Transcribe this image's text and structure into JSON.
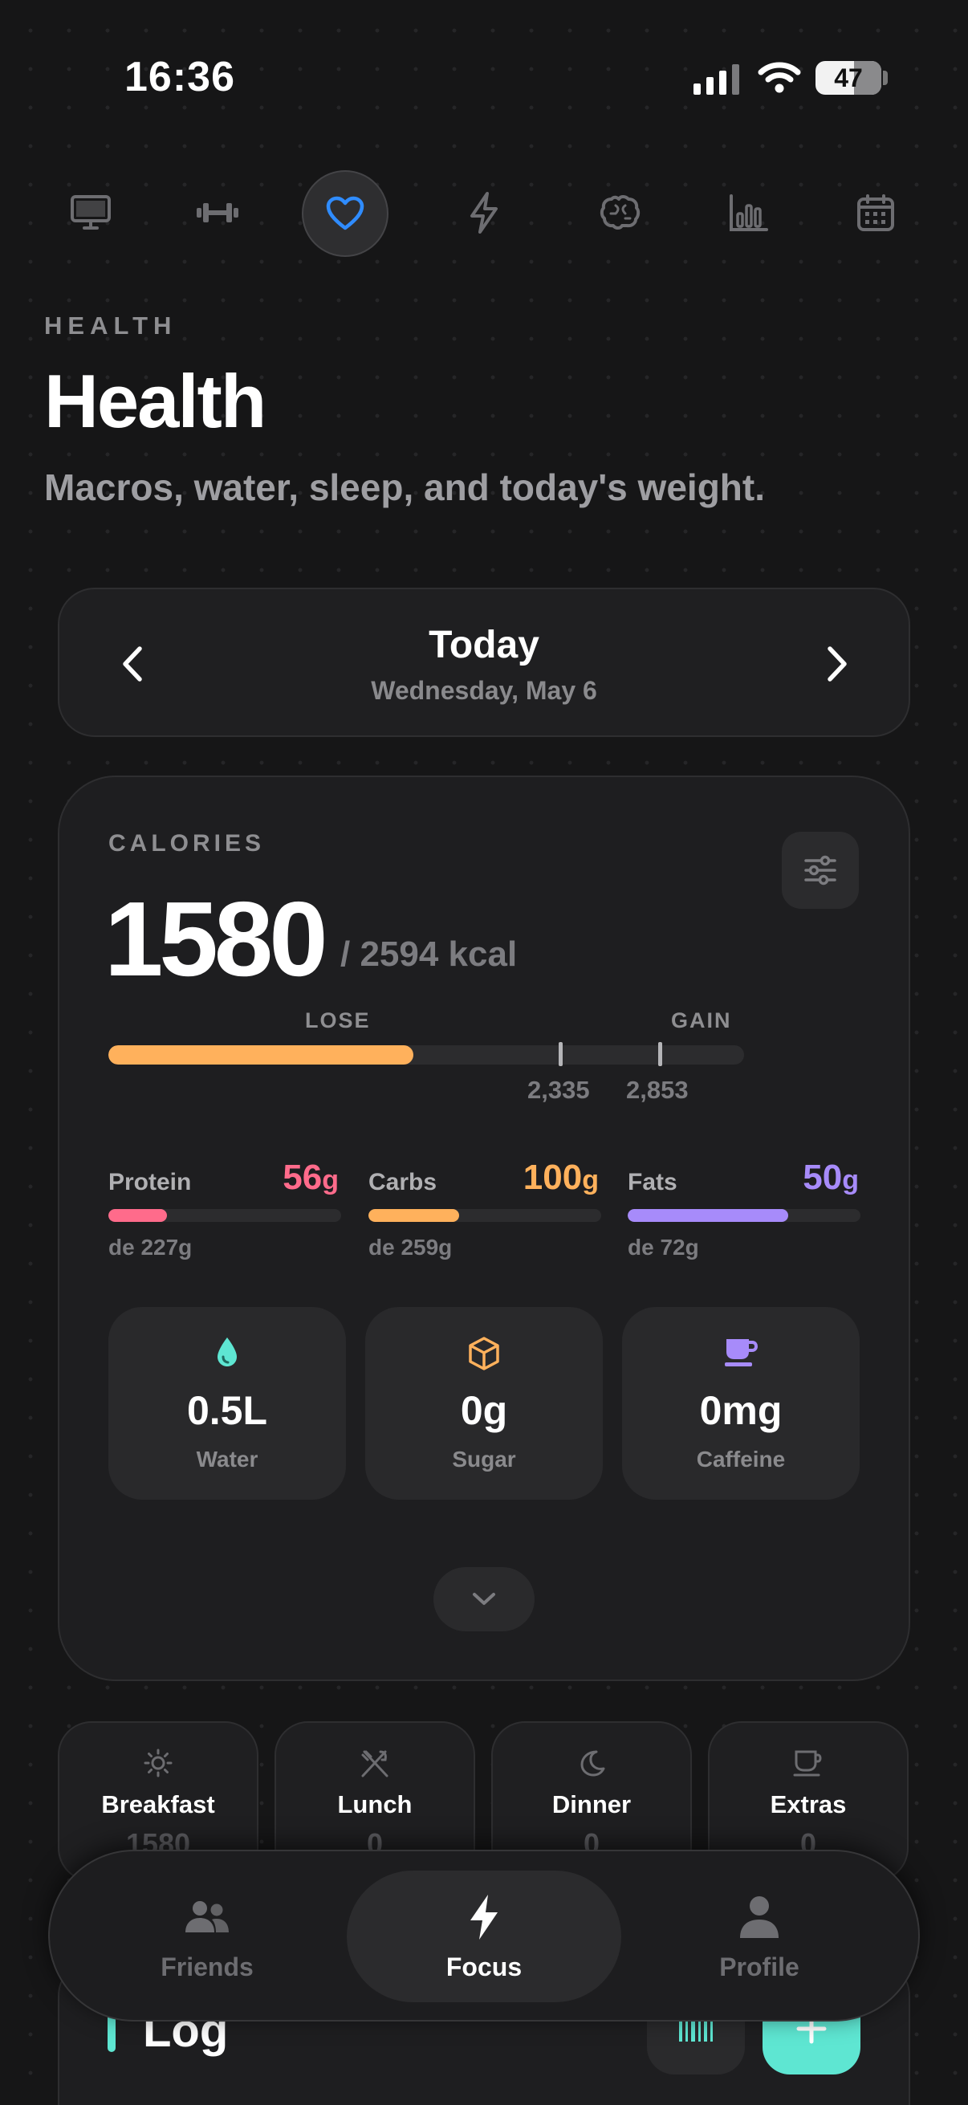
{
  "status_bar": {
    "time": "16:36",
    "battery": "47"
  },
  "top_nav": [
    "desktop-icon",
    "dumbbell-icon",
    "heart-icon",
    "bolt-icon",
    "brain-icon",
    "bar-chart-icon",
    "calendar-icon"
  ],
  "header": {
    "eyebrow": "HEALTH",
    "title": "Health",
    "subtitle": "Macros, water, sleep, and today's weight."
  },
  "date_nav": {
    "title": "Today",
    "subtitle": "Wednesday, May 6"
  },
  "calories": {
    "label": "CALORIES",
    "value": "1580",
    "goal": "/ 2594 kcal",
    "lose_label": "LOSE",
    "gain_label": "GAIN",
    "progress_fraction": 0.48,
    "marker_lose": "2,335",
    "marker_gain": "2,853"
  },
  "macros": [
    {
      "name": "Protein",
      "value": "56",
      "unit": "g",
      "of": "de 227g",
      "fraction": 0.25,
      "color": "#ff6b8b"
    },
    {
      "name": "Carbs",
      "value": "100",
      "unit": "g",
      "of": "de 259g",
      "fraction": 0.39,
      "color": "#ffb15c"
    },
    {
      "name": "Fats",
      "value": "50",
      "unit": "g",
      "of": "de 72g",
      "fraction": 0.69,
      "color": "#a78bfa"
    }
  ],
  "stats": [
    {
      "value": "0.5L",
      "label": "Water",
      "icon": "water-drop-icon",
      "color": "#5ee6d2"
    },
    {
      "value": "0g",
      "label": "Sugar",
      "icon": "cube-icon",
      "color": "#ffb15c"
    },
    {
      "value": "0mg",
      "label": "Caffeine",
      "icon": "mug-icon",
      "color": "#a78bfa"
    }
  ],
  "meals": [
    {
      "name": "Breakfast",
      "value": "1580",
      "icon": "sun-icon"
    },
    {
      "name": "Lunch",
      "value": "0",
      "icon": "fork-knife-icon"
    },
    {
      "name": "Dinner",
      "value": "0",
      "icon": "moon-icon"
    },
    {
      "name": "Extras",
      "value": "0",
      "icon": "cup-icon"
    }
  ],
  "log": {
    "title": "Log"
  },
  "bottom_nav": {
    "friends": "Friends",
    "focus": "Focus",
    "profile": "Profile"
  },
  "colors": {
    "accent_blue": "#2f8cff",
    "accent_teal": "#5ee6d2",
    "calorie_bar": "#ffb15c"
  }
}
